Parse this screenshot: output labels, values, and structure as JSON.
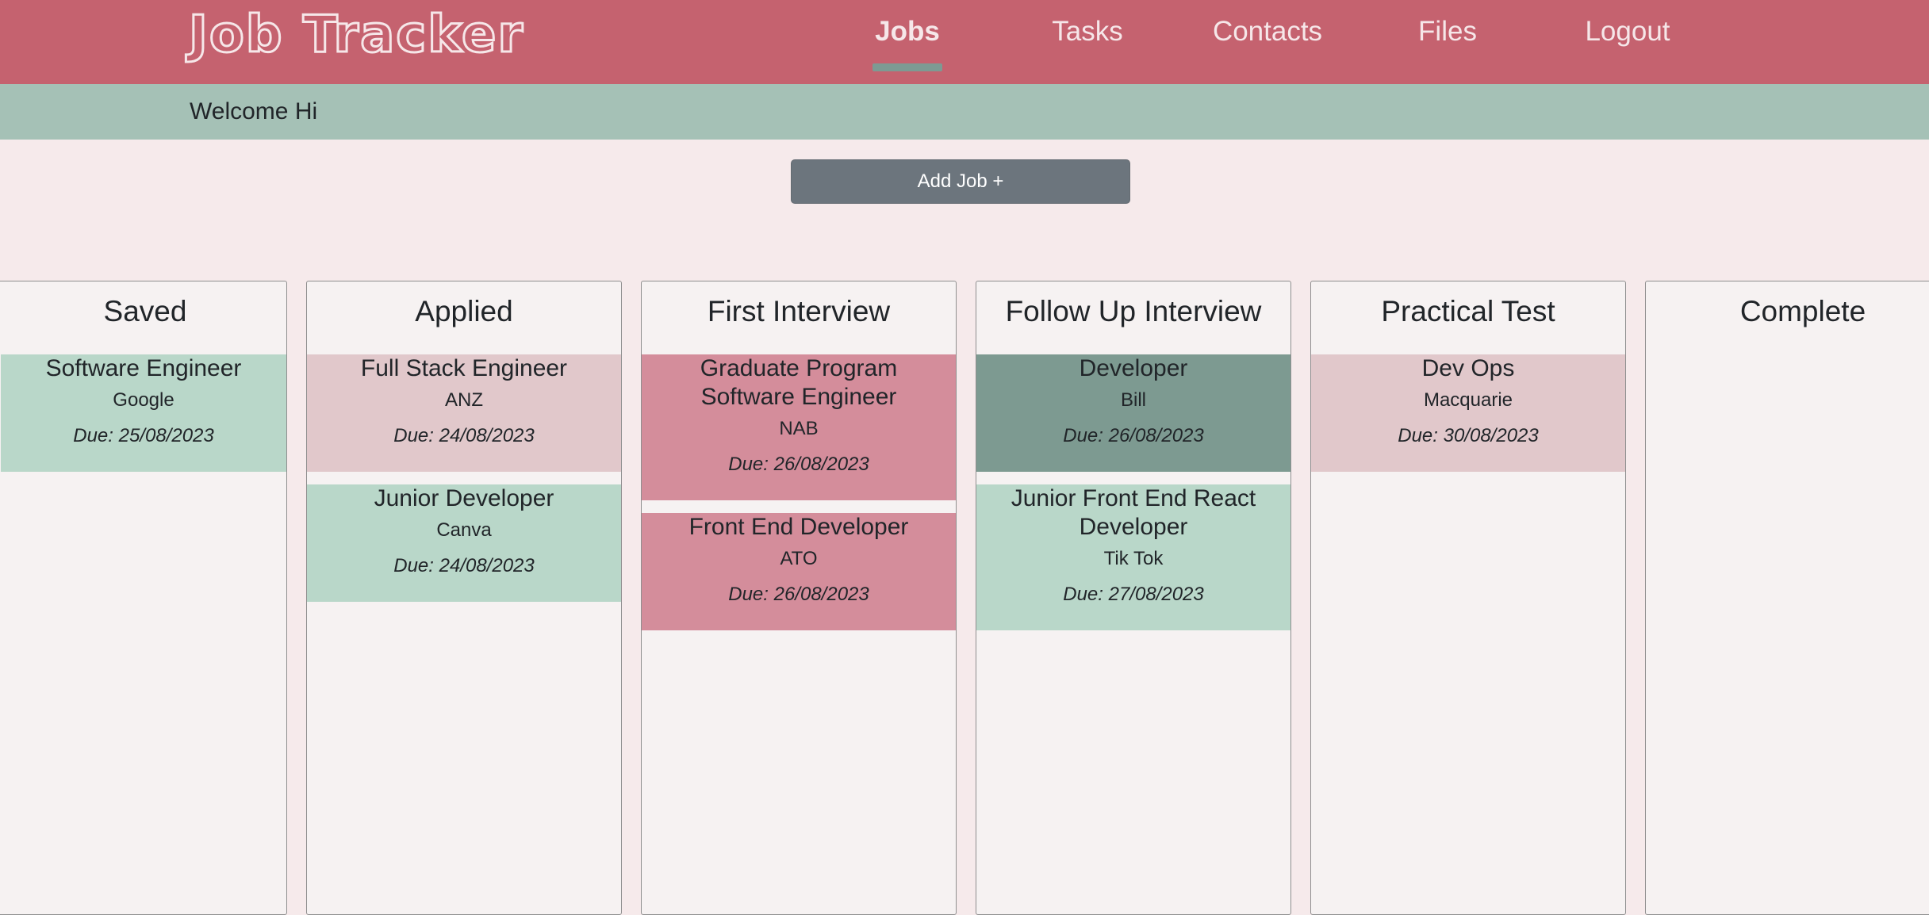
{
  "header": {
    "brand": "Job Tracker",
    "nav": [
      {
        "label": "Jobs",
        "active": true
      },
      {
        "label": "Tasks",
        "active": false
      },
      {
        "label": "Contacts",
        "active": false
      },
      {
        "label": "Files",
        "active": false
      },
      {
        "label": "Logout",
        "active": false
      }
    ]
  },
  "welcome": "Welcome Hi",
  "add_job_label": "Add Job +",
  "colors": {
    "header": "#c5626f",
    "welcome_bar": "#a5c1b6",
    "background": "#f6eaeb",
    "card_green": "#b9d7c9",
    "card_pale_pink": "#e1c8cb",
    "card_pink": "#d48d9b",
    "card_dark_green": "#7d9a91",
    "button": "#6c757d"
  },
  "columns": [
    {
      "title": "Saved",
      "jobs": [
        {
          "title": "Software Engineer",
          "company": "Google",
          "due": "Due: 25/08/2023",
          "color": "#b9d7c9"
        }
      ]
    },
    {
      "title": "Applied",
      "jobs": [
        {
          "title": "Full Stack Engineer",
          "company": "ANZ",
          "due": "Due: 24/08/2023",
          "color": "#e1c8cb"
        },
        {
          "title": "Junior Developer",
          "company": "Canva",
          "due": "Due: 24/08/2023",
          "color": "#b9d7c9"
        }
      ]
    },
    {
      "title": "First Interview",
      "jobs": [
        {
          "title": "Graduate Program Software Engineer",
          "company": "NAB",
          "due": "Due: 26/08/2023",
          "color": "#d48d9b"
        },
        {
          "title": "Front End Developer",
          "company": "ATO",
          "due": "Due: 26/08/2023",
          "color": "#d48d9b"
        }
      ]
    },
    {
      "title": "Follow Up Interview",
      "jobs": [
        {
          "title": "Developer",
          "company": "Bill",
          "due": "Due: 26/08/2023",
          "color": "#7d9a91"
        },
        {
          "title": "Junior Front End React Developer",
          "company": "Tik Tok",
          "due": "Due: 27/08/2023",
          "color": "#b9d7c9"
        }
      ]
    },
    {
      "title": "Practical Test",
      "jobs": [
        {
          "title": "Dev Ops",
          "company": "Macquarie",
          "due": "Due: 30/08/2023",
          "color": "#e1c8cb"
        }
      ]
    },
    {
      "title": "Complete",
      "jobs": []
    }
  ]
}
